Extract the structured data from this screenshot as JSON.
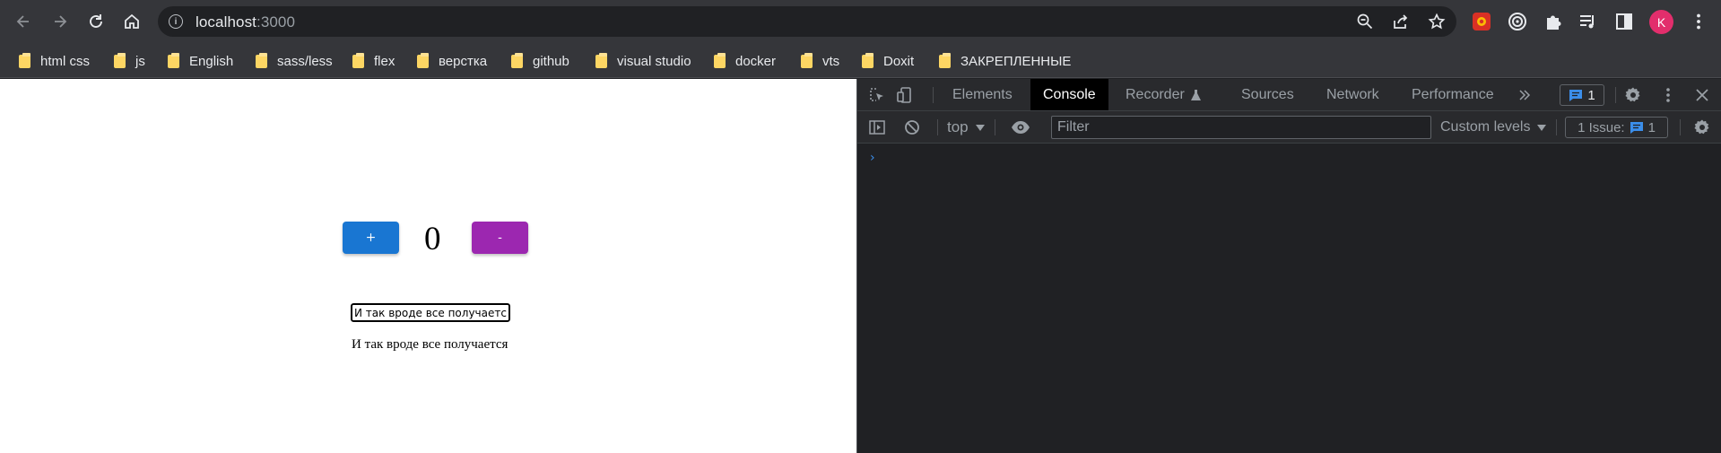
{
  "browser": {
    "url_host": "localhost",
    "url_port": ":3000",
    "avatar_letter": "K"
  },
  "bookmarks": [
    {
      "label": "html css"
    },
    {
      "label": "js"
    },
    {
      "label": "English"
    },
    {
      "label": "sass/less"
    },
    {
      "label": "flex"
    },
    {
      "label": "верстка"
    },
    {
      "label": "github"
    },
    {
      "label": "visual studio"
    },
    {
      "label": "docker"
    },
    {
      "label": "vts"
    },
    {
      "label": "Doxit"
    },
    {
      "label": "ЗАКРЕПЛЕННЫЕ"
    }
  ],
  "app": {
    "plus_label": "+",
    "minus_label": "-",
    "counter": "0",
    "input_value": "И так вроде все получается",
    "echo_text": "И так вроде все получается",
    "colors": {
      "plus": "#1976d2",
      "minus": "#9c27b0"
    }
  },
  "devtools": {
    "tabs": [
      {
        "label": "Elements"
      },
      {
        "label": "Console",
        "active": true
      },
      {
        "label": "Recorder"
      },
      {
        "label": "Sources"
      },
      {
        "label": "Network"
      },
      {
        "label": "Performance"
      }
    ],
    "issues_badge_count": "1",
    "context": "top",
    "filter_placeholder": "Filter",
    "levels_label": "Custom levels",
    "issue_count_label": "1 Issue:",
    "issue_count_value": "1",
    "prompt_symbol": "›"
  }
}
